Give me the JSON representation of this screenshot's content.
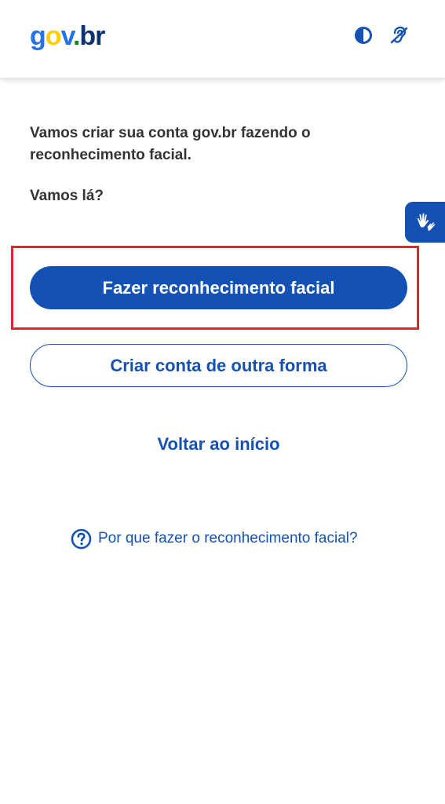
{
  "header": {
    "logo": {
      "g": "g",
      "o": "o",
      "v": "v",
      "dot": ".",
      "br": "br"
    },
    "icons": [
      "contrast-icon",
      "hearing-icon"
    ]
  },
  "main": {
    "intro": "Vamos criar sua conta gov.br fazendo o reconhecimento facial.",
    "question": "Vamos lá?",
    "primary_button": "Fazer reconhecimento facial",
    "secondary_button": "Criar conta de outra forma",
    "back_link": "Voltar ao início",
    "help_link": "Por que fazer o reconhecimento facial?"
  },
  "vlibras": {
    "icon": "sign-language-hands-icon"
  },
  "colors": {
    "primary": "#1351b4",
    "text": "#333333",
    "highlight": "#e0242c",
    "logo_blue": "#2670e8",
    "logo_yellow": "#ffcd07",
    "logo_green": "#168821",
    "logo_dark": "#0c326f"
  }
}
